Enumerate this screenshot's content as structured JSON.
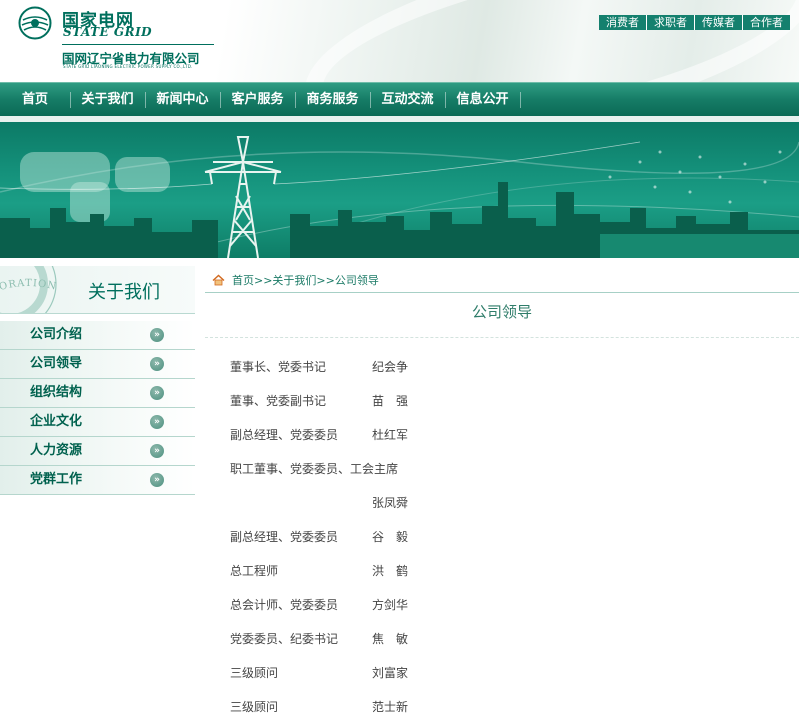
{
  "header": {
    "logo_cn": "国家电网",
    "logo_en": "STATE GRID",
    "company_cn": "国网辽宁省电力有限公司",
    "company_en": "STATE GRID LIAONING ELECTRIC POWER SUPPLY CO.,LTD.",
    "top_links": [
      "消费者",
      "求职者",
      "传媒者",
      "合作者"
    ]
  },
  "nav": {
    "items": [
      "首页",
      "关于我们",
      "新闻中心",
      "客户服务",
      "商务服务",
      "互动交流",
      "信息公开"
    ]
  },
  "sidebar": {
    "title": "关于我们",
    "seal_text": "CORPORATION OF",
    "items": [
      "公司介绍",
      "公司领导",
      "组织结构",
      "企业文化",
      "人力资源",
      "党群工作"
    ],
    "arrow_glyph": "»"
  },
  "breadcrumb": "首页>>关于我们>>公司领导",
  "page_title": "公司领导",
  "leaders": [
    {
      "position": "董事长、党委书记",
      "name": "纪会争"
    },
    {
      "position": "董事、党委副书记",
      "name": "苗　强"
    },
    {
      "position": "副总经理、党委委员",
      "name": "杜红军"
    },
    {
      "position": "职工董事、党委委员、工会主席",
      "name": ""
    },
    {
      "position": "",
      "name": "张凤舜"
    },
    {
      "position": "副总经理、党委委员",
      "name": "谷　毅"
    },
    {
      "position": "总工程师",
      "name": "洪　鹤"
    },
    {
      "position": "总会计师、党委委员",
      "name": "方剑华"
    },
    {
      "position": "党委委员、纪委书记",
      "name": "焦　敏"
    },
    {
      "position": "三级顾问",
      "name": "刘富家"
    },
    {
      "position": "三级顾问",
      "name": "范士新"
    }
  ],
  "colors": {
    "brand": "#006f5d",
    "nav": "#167c66",
    "toplink": "#14806e"
  }
}
